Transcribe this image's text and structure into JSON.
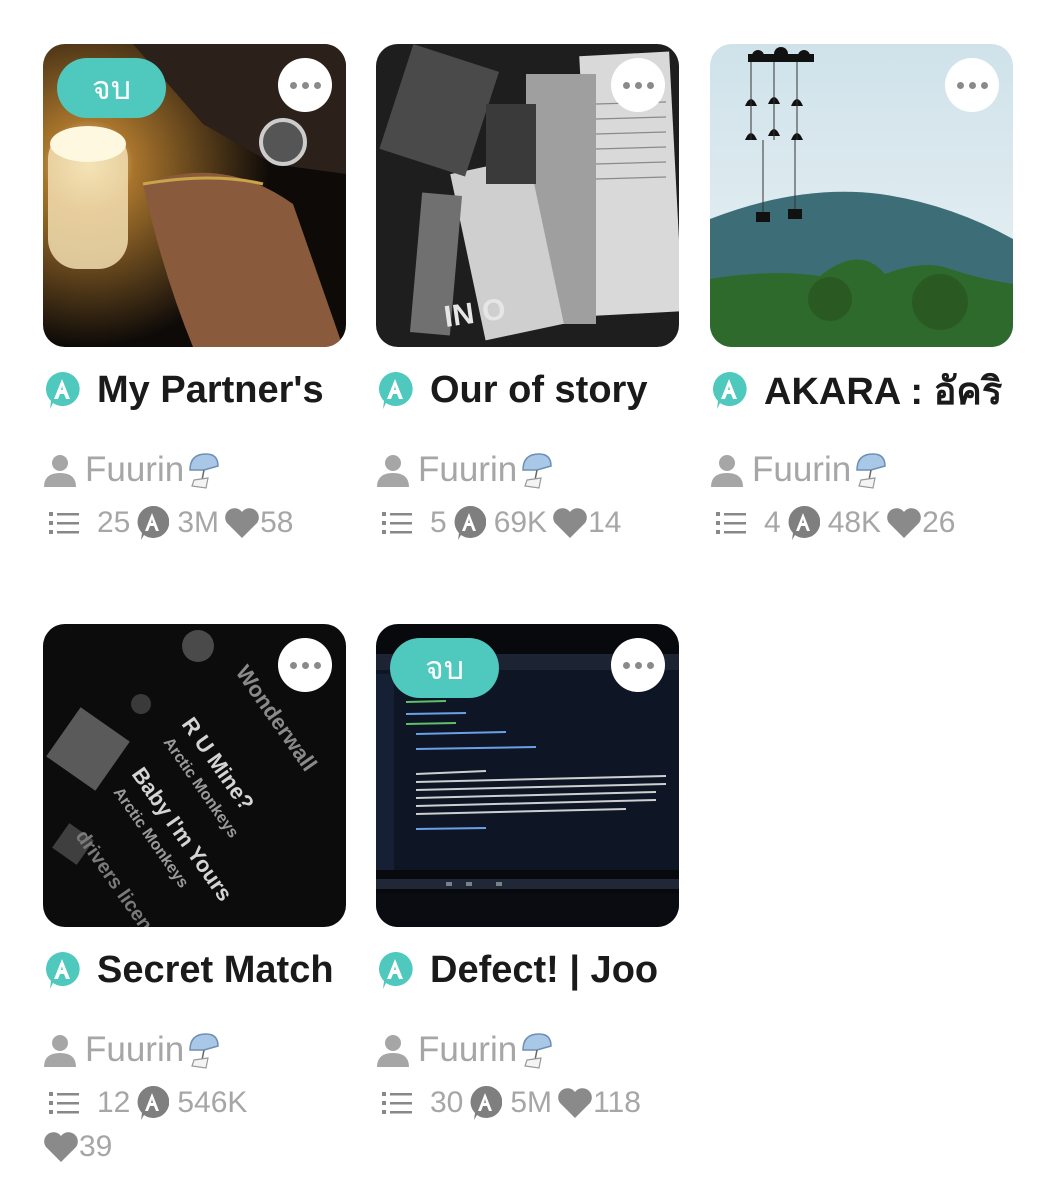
{
  "stories": [
    {
      "title": "My Partner's",
      "badge": "จบ",
      "author": "Fuurin",
      "chapters": "25",
      "views": "3M",
      "likes": "58"
    },
    {
      "title": "Our of story",
      "badge": "",
      "author": "Fuurin",
      "chapters": "5",
      "views": "69K",
      "likes": "14"
    },
    {
      "title": "AKARA : อัคริ",
      "badge": "",
      "author": "Fuurin",
      "chapters": "4",
      "views": "48K",
      "likes": "26"
    },
    {
      "title": "Secret Match",
      "badge": "",
      "author": "Fuurin",
      "chapters": "12",
      "views": "546K",
      "likes": "39"
    },
    {
      "title": "Defect! | Joo",
      "badge": "จบ",
      "author": "Fuurin",
      "chapters": "30",
      "views": "5M",
      "likes": "118"
    }
  ],
  "cover_text": {
    "story2_book": "IN O",
    "story4_song1": "R U Mine?",
    "story4_artist1": "Arctic Monkeys",
    "story4_song2": "Baby I'm Yours",
    "story4_artist2": "Arctic Monkeys",
    "story4_song3": "Wonderwall",
    "story4_song4": "drivers license"
  },
  "icons": {
    "tag": "a-tag-icon",
    "author": "person-icon",
    "charm": "wind-chime-icon",
    "chapters": "list-icon",
    "views": "view-count-icon",
    "likes": "heart-icon",
    "more": "more-dots-icon"
  },
  "colors": {
    "accent": "#4fc8bd",
    "muted": "#a6a6a6"
  }
}
